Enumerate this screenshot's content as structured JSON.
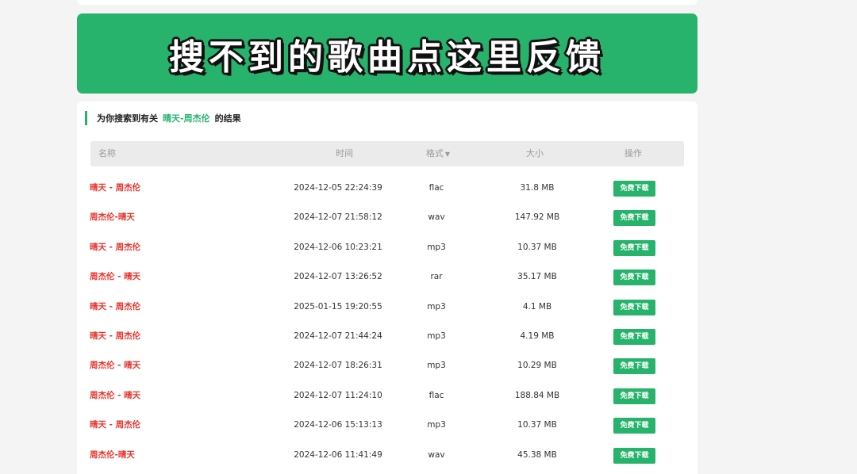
{
  "banner": {
    "text": "搜不到的歌曲点这里反馈"
  },
  "result_heading": {
    "prefix": "为你搜索到有关",
    "keyword": "晴天-周杰伦",
    "suffix": "的结果"
  },
  "table": {
    "headers": {
      "name": "名称",
      "time": "时间",
      "format": "格式",
      "size": "大小",
      "action": "操作"
    },
    "format_sort_icon": "caret-down-icon",
    "download_label": "免费下载",
    "rows": [
      {
        "name": "晴天 - 周杰伦",
        "time": "2024-12-05 22:24:39",
        "format": "flac",
        "size": "31.8 MB"
      },
      {
        "name": "周杰伦-晴天",
        "time": "2024-12-07 21:58:12",
        "format": "wav",
        "size": "147.92 MB"
      },
      {
        "name": "晴天 - 周杰伦",
        "time": "2024-12-06 10:23:21",
        "format": "mp3",
        "size": "10.37 MB"
      },
      {
        "name": "周杰伦 - 晴天",
        "time": "2024-12-07 13:26:52",
        "format": "rar",
        "size": "35.17 MB"
      },
      {
        "name": "晴天 - 周杰伦",
        "time": "2025-01-15 19:20:55",
        "format": "mp3",
        "size": "4.1 MB"
      },
      {
        "name": "晴天 - 周杰伦",
        "time": "2024-12-07 21:44:24",
        "format": "mp3",
        "size": "4.19 MB"
      },
      {
        "name": "周杰伦 - 晴天",
        "time": "2024-12-07 18:26:31",
        "format": "mp3",
        "size": "10.29 MB"
      },
      {
        "name": "周杰伦 - 晴天",
        "time": "2024-12-07 11:24:10",
        "format": "flac",
        "size": "188.84 MB"
      },
      {
        "name": "晴天 - 周杰伦",
        "time": "2024-12-06 15:13:13",
        "format": "mp3",
        "size": "10.37 MB"
      },
      {
        "name": "周杰伦-晴天",
        "time": "2024-12-06 11:41:49",
        "format": "wav",
        "size": "45.38 MB"
      }
    ]
  },
  "colors": {
    "accent": "#27b36c",
    "song_name": "#e8342c"
  }
}
